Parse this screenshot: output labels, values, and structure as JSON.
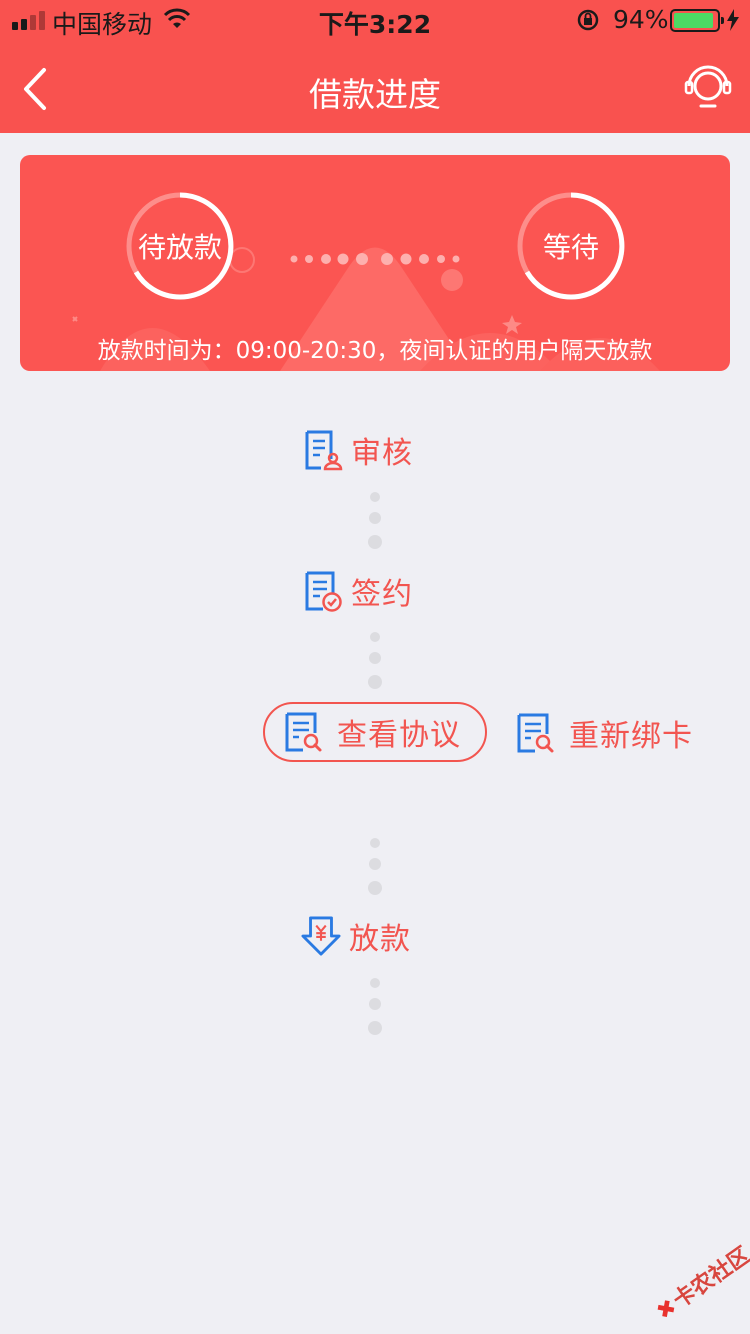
{
  "status_bar": {
    "carrier": "中国移动",
    "time": "下午3:22",
    "battery_percent": "94%",
    "battery_level": 0.94
  },
  "nav": {
    "title": "借款进度"
  },
  "banner": {
    "left_status": "待放款",
    "right_status": "等待",
    "note": "放款时间为：09:00-20:30，夜间认证的用户隔天放款"
  },
  "steps": {
    "review": "审核",
    "sign": "签约",
    "view_agreement": "查看协议",
    "rebind_card": "重新绑卡",
    "disburse": "放款"
  },
  "watermark": "卡农社区",
  "colors": {
    "brand_red": "#f9524f",
    "icon_blue": "#2a7ae2",
    "text_red": "#f25550",
    "background": "#efeff4"
  }
}
